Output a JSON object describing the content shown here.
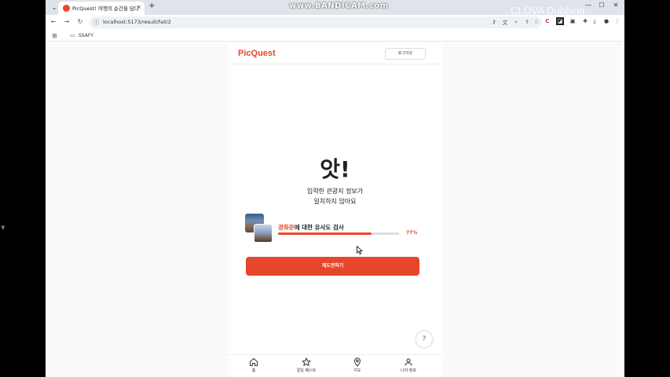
{
  "browser": {
    "tab_title": "PicQuest! 여행의 순간을 담다",
    "tab_close": "×",
    "new_tab": "+",
    "url": "localhost:5173/result/fail/2",
    "bookmark_folder": "SSAFY"
  },
  "watermarks": {
    "bandicam": "www.BANDICAM.com",
    "clova": "CLOVA Dubbing"
  },
  "app": {
    "logo": "PicQuest",
    "logout_label": "로그아웃",
    "headline": "앗!",
    "message_line1": "입력한 관광지 정보가",
    "message_line2": "일치하지 않아요",
    "similarity": {
      "place": "광화문",
      "suffix": "에 대한 유사도 검사",
      "percent_label": "77%",
      "percent_value": 77
    },
    "retry_button": "재도전하기",
    "help_icon": "?",
    "nav": [
      {
        "label": "홈",
        "icon": "home-icon"
      },
      {
        "label": "일일 퀘스트",
        "icon": "star-icon"
      },
      {
        "label": "지도",
        "icon": "map-pin-icon"
      },
      {
        "label": "나의 정보",
        "icon": "user-icon"
      }
    ]
  },
  "colors": {
    "accent": "#e8462a",
    "track": "#dddddd"
  }
}
